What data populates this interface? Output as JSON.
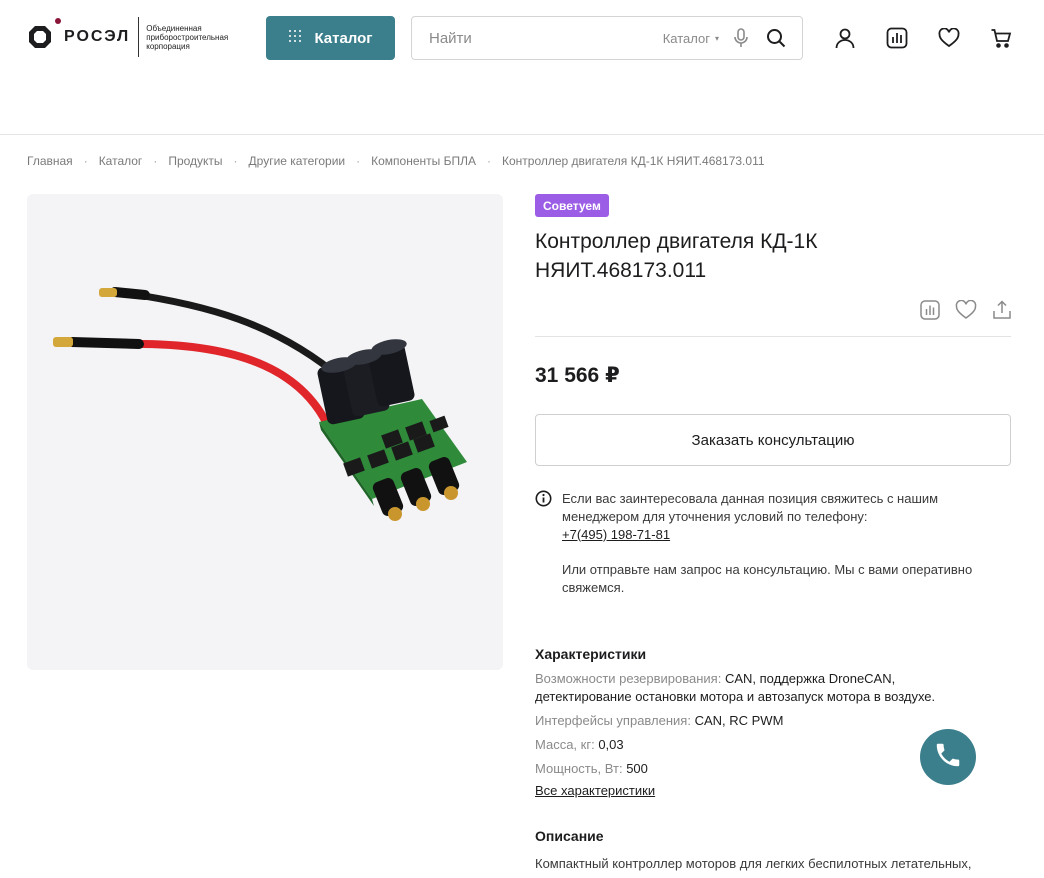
{
  "header": {
    "logo_text": "РОСЭЛ",
    "logo_subtitle": "Объединенная приборостроительная корпорация",
    "catalog_label": "Каталог",
    "search_placeholder": "Найти",
    "search_scope": "Каталог",
    "icons": [
      "user-icon",
      "compare-icon",
      "heart-icon",
      "cart-icon"
    ]
  },
  "breadcrumb": [
    "Главная",
    "Каталог",
    "Продукты",
    "Другие категории",
    "Компоненты БПЛА",
    "Контроллер двигателя КД-1К НЯИТ.468173.011"
  ],
  "product": {
    "badge": "Советуем",
    "title_line1": "Контроллер двигателя КД-1К",
    "title_line2": "НЯИТ.468173.011",
    "price": "31 566 ₽",
    "consult_label": "Заказать консультацию",
    "info_text": "Если вас заинтересовала данная позиция свяжитесь с нашим менеджером для уточнения условий по телефону:",
    "phone": "+7(495) 198-71-81",
    "info_text2": "Или отправьте нам запрос на консультацию. Мы с вами оперативно свяжемся."
  },
  "specs": {
    "title": "Характеристики",
    "items": [
      {
        "key": "Возможности резервирования:",
        "value": "CAN, поддержка DroneCAN, детектирование остановки мотора и автозапуск мотора в воздухе."
      },
      {
        "key": "Интерфейсы управления:",
        "value": "CAN, RC PWM"
      },
      {
        "key": "Масса, кг:",
        "value": "0,03"
      },
      {
        "key": "Мощность, Вт:",
        "value": "500"
      }
    ],
    "all_label": "Все характеристики"
  },
  "description": {
    "title": "Описание",
    "text": "Компактный контроллер моторов для легких беспилотных летательных,"
  },
  "colors": {
    "accent": "#3c7f8c",
    "badge": "#9b5de5",
    "brand_dot": "#8a1538"
  }
}
